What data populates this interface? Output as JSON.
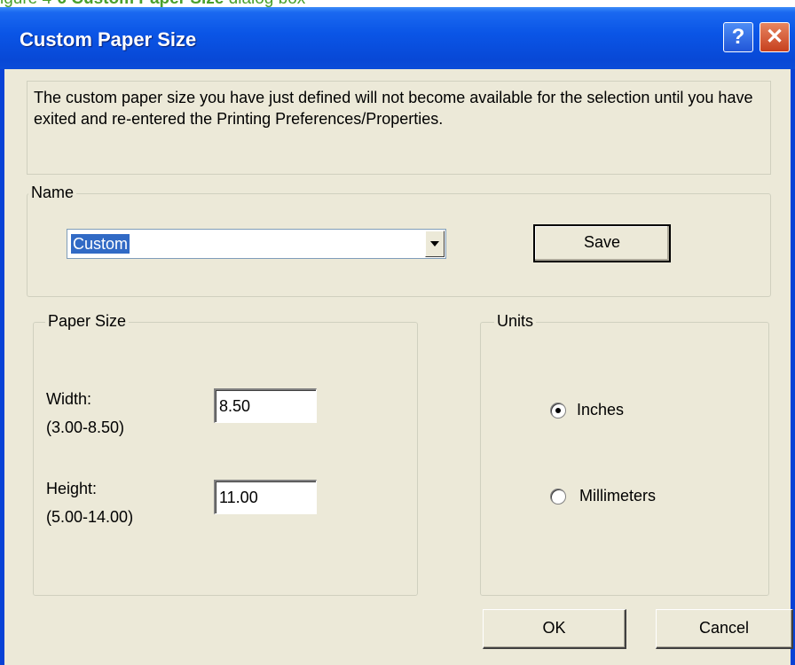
{
  "caption_fragment": {
    "prefix": "igure 4-",
    "bold": "6 Custom Paper Size",
    "suffix": " dialog box"
  },
  "dialog": {
    "title": "Custom Paper Size",
    "help_icon": "question-mark-icon",
    "close_icon": "close-x-icon",
    "notice": "The custom paper size you have just defined will not become available for the selection until you have exited and re-entered the Printing Preferences/Properties.",
    "name_group": {
      "legend": "Name",
      "combo_value": "Custom",
      "save_label": "Save"
    },
    "paper_size_group": {
      "legend": "Paper Size",
      "width_label": "Width:",
      "width_range": "(3.00-8.50)",
      "width_value": "8.50",
      "height_label": "Height:",
      "height_range": "(5.00-14.00)",
      "height_value": "11.00"
    },
    "units_group": {
      "legend": "Units",
      "options": [
        {
          "label": "Inches",
          "selected": true
        },
        {
          "label": "Millimeters",
          "selected": false
        }
      ]
    },
    "ok_label": "OK",
    "cancel_label": "Cancel"
  },
  "colors": {
    "titlebar": "#0a55e6",
    "client_background": "#ece9d8",
    "selection": "#316ac5",
    "close_button": "#d2562e"
  }
}
